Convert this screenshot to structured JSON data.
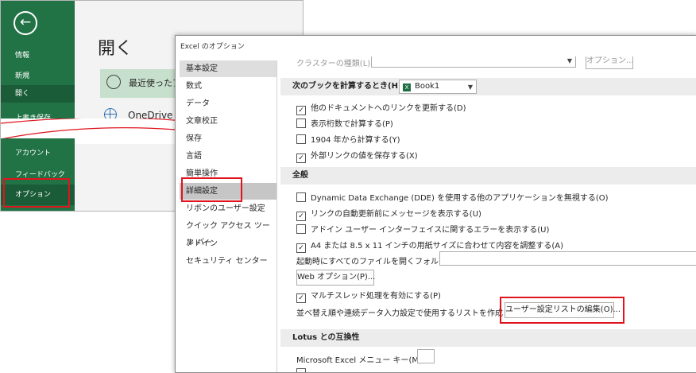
{
  "backstage": {
    "back_symbol": "←",
    "nav_top": [
      "情報",
      "新規",
      "開く",
      "上書き保存"
    ],
    "nav_bottom": [
      "アカウント",
      "フィードバック",
      "オプション"
    ],
    "title": "開く",
    "recent_label": "最近使ったアイ",
    "onedrive_label": "OneDrive",
    "clock_symbol": "🕓"
  },
  "dialog": {
    "title": "Excel のオプション",
    "nav_items": [
      "基本設定",
      "数式",
      "データ",
      "文章校正",
      "保存",
      "言語",
      "簡単操作",
      "詳細設定",
      "リボンのユーザー設定",
      "クイック アクセス ツール バー",
      "アドイン",
      "セキュリティ センター"
    ],
    "selected_index": 7,
    "top_partial_label": "クラスターの種類(L):",
    "top_partial_button": "オプション...",
    "calc_section": {
      "label": "次のブックを計算するとき(H):",
      "book": "Book1",
      "options": [
        {
          "label": "他のドキュメントへのリンクを更新する(D)",
          "checked": true
        },
        {
          "label": "表示桁数で計算する(P)",
          "checked": false
        },
        {
          "label": "1904 年から計算する(Y)",
          "checked": false
        },
        {
          "label": "外部リンクの値を保存する(X)",
          "checked": true
        }
      ]
    },
    "general_section": {
      "title": "全般",
      "options": [
        {
          "label": "Dynamic Data Exchange (DDE) を使用する他のアプリケーションを無視する(O)",
          "checked": false
        },
        {
          "label": "リンクの自動更新前にメッセージを表示する(U)",
          "checked": true
        },
        {
          "label": "アドイン ユーザー インターフェイスに関するエラーを表示する(U)",
          "checked": false
        },
        {
          "label": "A4 または 8.5 x 11 インチの用紙サイズに合わせて内容を調整する(A)",
          "checked": true
        }
      ],
      "startup_folder_label": "起動時にすべてのファイルを開くフォルダー(L):",
      "web_options_button": "Web オプション(P)...",
      "multithread": {
        "label": "マルチスレッド処理を有効にする(P)",
        "checked": true
      },
      "sort_list_label": "並べ替え順や連続データ入力設定で使用するリストを作成します:",
      "edit_custom_lists_button": "ユーザー設定リストの編集(O)..."
    },
    "lotus_section": {
      "title": "Lotus との互換性",
      "menu_key_label": "Microsoft Excel メニュー キー(M):",
      "menu_key_value": ""
    }
  },
  "check_mark": "✓",
  "colors": {
    "excel_green": "#217346",
    "highlight_red": "#e0141e"
  }
}
